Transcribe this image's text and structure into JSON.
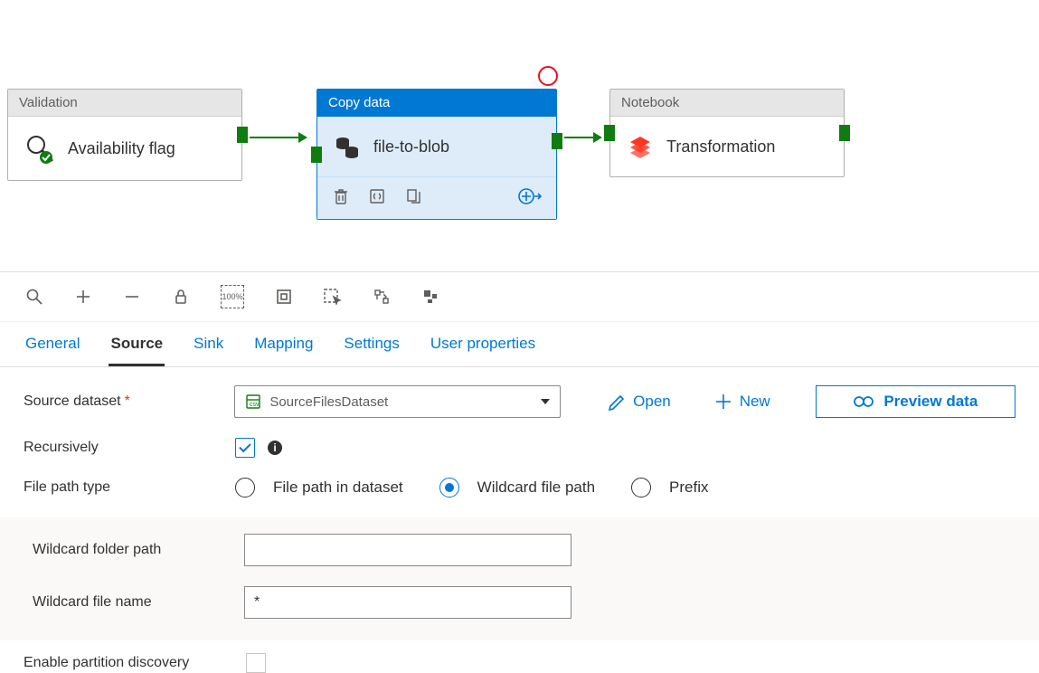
{
  "canvas": {
    "validation": {
      "title": "Validation",
      "label": "Availability flag"
    },
    "copy": {
      "title": "Copy data",
      "label": "file-to-blob"
    },
    "notebook": {
      "title": "Notebook",
      "label": "Transformation"
    }
  },
  "tabs": {
    "general": "General",
    "source": "Source",
    "sink": "Sink",
    "mapping": "Mapping",
    "settings": "Settings",
    "user": "User properties"
  },
  "form": {
    "source_dataset_label": "Source dataset",
    "source_dataset_value": "SourceFilesDataset",
    "open": "Open",
    "new": "New",
    "preview": "Preview data",
    "recursively_label": "Recursively",
    "file_path_type_label": "File path type",
    "fpt_opt1": "File path in dataset",
    "fpt_opt2": "Wildcard file path",
    "fpt_opt3": "Prefix",
    "wildcard_folder_label": "Wildcard folder path",
    "wildcard_folder_value": "",
    "wildcard_file_label": "Wildcard file name",
    "wildcard_file_value": "*",
    "partition_label": "Enable partition discovery"
  }
}
